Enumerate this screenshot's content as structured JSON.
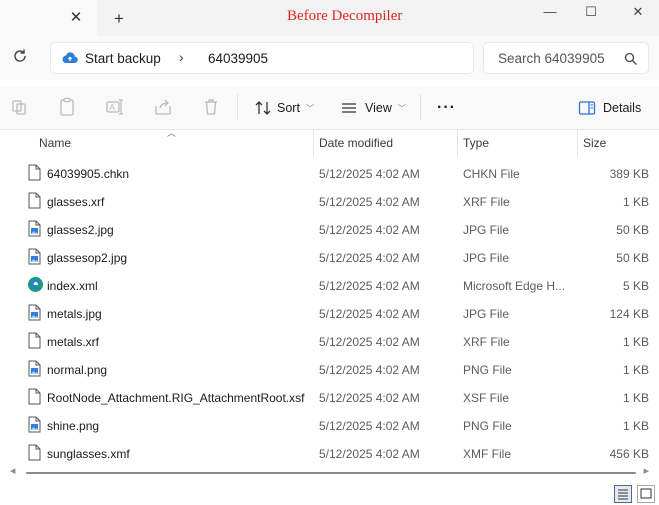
{
  "window": {
    "title": "Before Decompiler",
    "title_color": "#e0261c"
  },
  "tabs": {
    "close_glyph": "✕",
    "new_tab_glyph": "+"
  },
  "controls": {
    "minimize": "—",
    "maximize": "☐",
    "close": "✕"
  },
  "address": {
    "crumbs": [
      "Start backup",
      "64039905"
    ],
    "separator": "›",
    "icon": "cloud-backup-icon"
  },
  "search": {
    "placeholder": "Search 64039905"
  },
  "commandbar": {
    "sort_label": "Sort",
    "view_label": "View",
    "more_label": "···",
    "details_label": "Details"
  },
  "columns": {
    "name": "Name",
    "date": "Date modified",
    "type": "Type",
    "size": "Size"
  },
  "files": [
    {
      "name": "64039905.chkn",
      "date": "5/12/2025 4:02 AM",
      "type": "CHKN File",
      "size": "389 KB",
      "icon": "file"
    },
    {
      "name": "glasses.xrf",
      "date": "5/12/2025 4:02 AM",
      "type": "XRF File",
      "size": "1 KB",
      "icon": "file"
    },
    {
      "name": "glasses2.jpg",
      "date": "5/12/2025 4:02 AM",
      "type": "JPG File",
      "size": "50 KB",
      "icon": "image"
    },
    {
      "name": "glassesop2.jpg",
      "date": "5/12/2025 4:02 AM",
      "type": "JPG File",
      "size": "50 KB",
      "icon": "image"
    },
    {
      "name": "index.xml",
      "date": "5/12/2025 4:02 AM",
      "type": "Microsoft Edge H...",
      "size": "5 KB",
      "icon": "edge"
    },
    {
      "name": "metals.jpg",
      "date": "5/12/2025 4:02 AM",
      "type": "JPG File",
      "size": "124 KB",
      "icon": "image"
    },
    {
      "name": "metals.xrf",
      "date": "5/12/2025 4:02 AM",
      "type": "XRF File",
      "size": "1 KB",
      "icon": "file"
    },
    {
      "name": "normal.png",
      "date": "5/12/2025 4:02 AM",
      "type": "PNG File",
      "size": "1 KB",
      "icon": "image"
    },
    {
      "name": "RootNode_Attachment.RIG_AttachmentRoot.xsf",
      "date": "5/12/2025 4:02 AM",
      "type": "XSF File",
      "size": "1 KB",
      "icon": "file"
    },
    {
      "name": "shine.png",
      "date": "5/12/2025 4:02 AM",
      "type": "PNG File",
      "size": "1 KB",
      "icon": "image"
    },
    {
      "name": "sunglasses.xmf",
      "date": "5/12/2025 4:02 AM",
      "type": "XMF File",
      "size": "456 KB",
      "icon": "file"
    }
  ]
}
